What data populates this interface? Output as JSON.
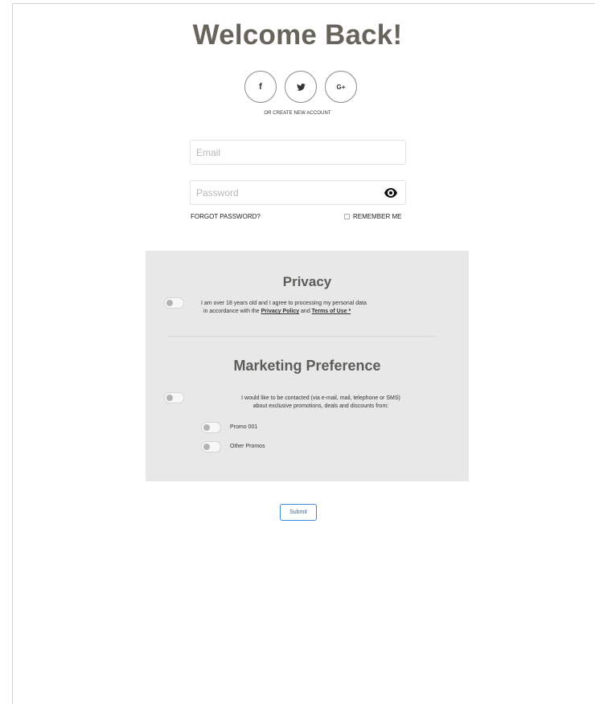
{
  "header": {
    "title": "Welcome Back!"
  },
  "social": {
    "facebook_label": "f",
    "twitter_label": "",
    "google_label": "G+",
    "create_account": "OR CREATE NEW ACCOUNT"
  },
  "form": {
    "email_placeholder": "Email",
    "password_placeholder": "Password",
    "forgot_password": "FORGOT PASSWORD?",
    "remember_me": "REMEMBER ME"
  },
  "privacy": {
    "title": "Privacy",
    "text_before": "I am over 18 years old and I agree to processing my personal data",
    "text_line2_start": "in accordance with the ",
    "privacy_policy_link": "Privacy Policy",
    "and": " and ",
    "terms_link": "Terms of Use *",
    "toggle_on": false
  },
  "marketing": {
    "title": "Marketing Preference",
    "text_line1": "I would like to be contacted (via e-mail, mail, telephone or SMS)",
    "text_line2": "about exclusive promotions, deals and discounts from:",
    "toggle_on": false,
    "options": [
      {
        "label": "Promo 001",
        "on": false
      },
      {
        "label": "Other Promos",
        "on": false
      }
    ]
  },
  "actions": {
    "submit_label": "Submit"
  },
  "colors": {
    "title": "#67645c",
    "panel_bg": "#e8e8e8",
    "submit_border": "#3a88d6",
    "toggle_knob": "#b3b3b3"
  },
  "icons": {
    "facebook": "facebook-icon",
    "twitter": "twitter-icon",
    "google_plus": "google-plus-icon",
    "show_password": "eye-icon"
  }
}
